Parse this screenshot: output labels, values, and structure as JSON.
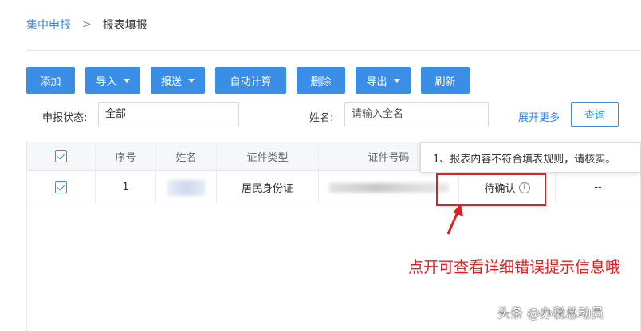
{
  "breadcrumb": {
    "parent": "集中申报",
    "separator": ">",
    "current": "报表填报"
  },
  "toolbar": {
    "add": "添加",
    "import": "导入",
    "submit": "报送",
    "auto_calc": "自动计算",
    "delete": "删除",
    "export": "导出",
    "refresh": "刷新"
  },
  "filters": {
    "status_label": "申报状态:",
    "status_value": "全部",
    "name_label": "姓名:",
    "name_placeholder": "请输入全名",
    "expand_more": "展开更多",
    "query": "查询"
  },
  "table": {
    "headers": {
      "index": "序号",
      "name": "姓名",
      "id_type": "证件类型",
      "id_number": "证件号码"
    },
    "rows": [
      {
        "index": "1",
        "id_type": "居民身份证",
        "status": "待确认",
        "last": "--"
      }
    ]
  },
  "tooltip": {
    "message": "1、报表内容不符合填表规则，请核实。"
  },
  "annotation": {
    "text": "点开可查看详细错误提示信息哦"
  },
  "watermark": {
    "text": "头条 @办税总动员"
  },
  "colors": {
    "primary": "#3a8ee6",
    "link": "#3b85e0",
    "annotation_red": "#e02020"
  },
  "icons": {
    "info": "info-circle-icon",
    "dropdown": "caret-down-icon",
    "check": "checkbox-checked-icon"
  }
}
